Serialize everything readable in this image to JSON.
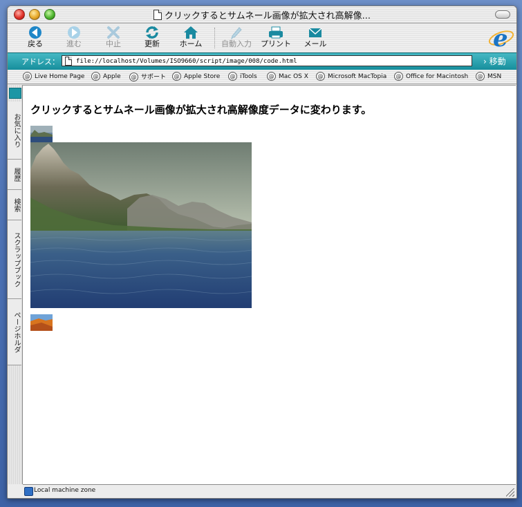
{
  "window": {
    "title": "クリックするとサムネール画像が拡大され高解像..."
  },
  "toolbar": {
    "back": "戻る",
    "forward": "進む",
    "stop": "中止",
    "refresh": "更新",
    "home": "ホーム",
    "autofill": "自動入力",
    "print": "プリント",
    "mail": "メール"
  },
  "address": {
    "label": "アドレス：",
    "url": "file://localhost/Volumes/ISO9660/script/image/008/code.html",
    "go": "移動"
  },
  "favorites": [
    "Live Home Page",
    "Apple",
    "サポート",
    "Apple Store",
    "iTools",
    "Mac OS X",
    "Microsoft MacTopia",
    "Office for Macintosh",
    "MSN"
  ],
  "sidebar_tabs": [
    "お気に入り",
    "履歴",
    "検索",
    "スクラップブック",
    "ページホルダ"
  ],
  "content": {
    "heading": "クリックするとサムネール画像が拡大され高解像度データに変わります。"
  },
  "status": {
    "zone": "Local machine zone"
  },
  "colors": {
    "accent_teal": "#168e9c",
    "ie_blue": "#1c74c4"
  }
}
